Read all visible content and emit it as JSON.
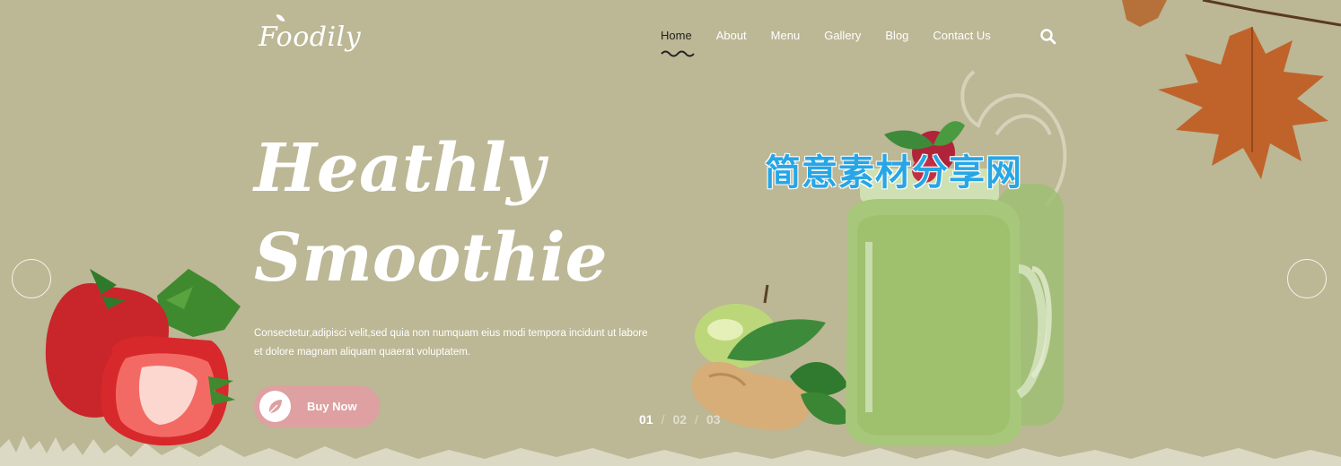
{
  "brand": {
    "logo_text": "Foodily"
  },
  "nav": {
    "items": [
      {
        "label": "Home",
        "active": true
      },
      {
        "label": "About"
      },
      {
        "label": "Menu"
      },
      {
        "label": "Gallery"
      },
      {
        "label": "Blog"
      },
      {
        "label": "Contact Us"
      }
    ],
    "search_icon": "search-icon"
  },
  "hero": {
    "title_line1": "Heathly",
    "title_line2": "Smoothie",
    "description": "Consectetur,adipisci velit,sed quia non numquam eius modi tempora incidunt ut labore et dolore magnam aliquam quaerat voluptatem.",
    "button_label": "Buy Now",
    "button_icon": "leaf-icon"
  },
  "slider": {
    "dots": [
      "01",
      "02",
      "03"
    ],
    "active_index": 0,
    "prev_icon": "circle-arrow-left",
    "next_icon": "circle-arrow-right"
  },
  "watermark": "简意素材分享网",
  "colors": {
    "background": "#bcb795",
    "accent": "#dea0a1",
    "text": "#ffffff",
    "active_nav": "#222222",
    "watermark": "#27a6e6"
  }
}
